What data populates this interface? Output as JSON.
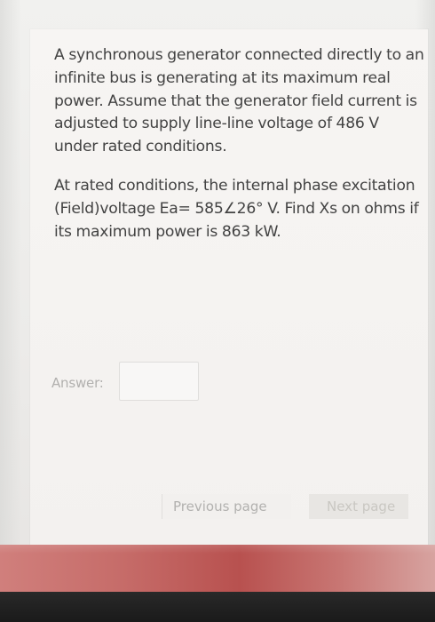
{
  "question": {
    "paragraph1_lines": [
      "A synchronous generator connected directly to an",
      "infinite bus is generating at its maximum real",
      "power. Assume that the generator field current is",
      "adjusted to supply line-line voltage of 486 V",
      "under rated conditions."
    ],
    "paragraph2_lines": [
      "At rated conditions, the internal phase excitation",
      "(Field)voltage Ea= 585∠26° V. Find Xs on ohms if",
      "its maximum power is 863 kW."
    ]
  },
  "answer": {
    "label": "Answer:",
    "value": ""
  },
  "navigation": {
    "previous_label": "Previous page",
    "next_label": "Next page"
  },
  "colors": {
    "text": "#434343",
    "muted": "#b1b0ae",
    "accent_strip": "#c66c69"
  }
}
